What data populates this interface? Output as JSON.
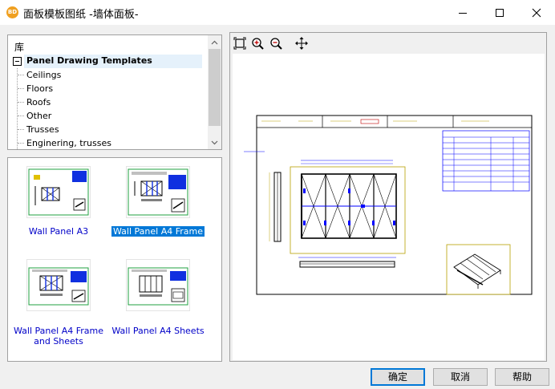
{
  "window": {
    "title": "面板模板图纸  -墙体面板-",
    "app_icon_text": "BD"
  },
  "tree": {
    "root_label": "库",
    "node_label": "Panel Drawing Templates",
    "children": [
      "Ceilings",
      "Floors",
      "Roofs",
      "Other",
      "Trusses",
      "Enginering, trusses"
    ]
  },
  "templates": [
    {
      "label": "Wall Panel A3",
      "selected": false
    },
    {
      "label": "Wall Panel A4 Frame",
      "selected": true
    },
    {
      "label": "Wall Panel A4 Frame and Sheets",
      "selected": false
    },
    {
      "label": "Wall Panel A4 Sheets",
      "selected": false
    }
  ],
  "buttons": {
    "ok": "确定",
    "cancel": "取消",
    "help": "帮助"
  },
  "colors": {
    "selection": "#0078d7",
    "link_text": "#0000c8",
    "drawing_line": "#000000",
    "drawing_accent": "#0000ff",
    "drawing_frame": "#b8a000"
  }
}
